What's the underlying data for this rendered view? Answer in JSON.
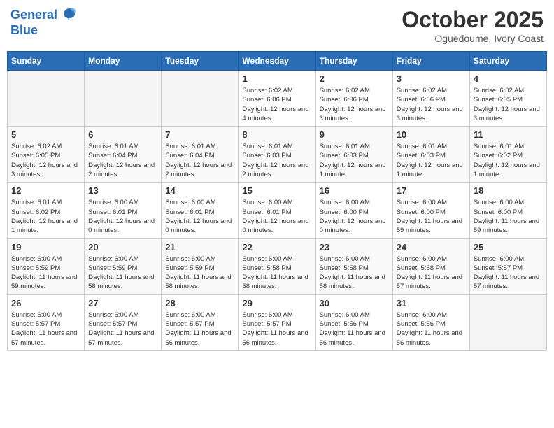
{
  "logo": {
    "line1": "General",
    "line2": "Blue"
  },
  "title": "October 2025",
  "location": "Oguedoume, Ivory Coast",
  "days_header": [
    "Sunday",
    "Monday",
    "Tuesday",
    "Wednesday",
    "Thursday",
    "Friday",
    "Saturday"
  ],
  "weeks": [
    {
      "days": [
        {
          "num": "",
          "info": ""
        },
        {
          "num": "",
          "info": ""
        },
        {
          "num": "",
          "info": ""
        },
        {
          "num": "1",
          "info": "Sunrise: 6:02 AM\nSunset: 6:06 PM\nDaylight: 12 hours and 4 minutes."
        },
        {
          "num": "2",
          "info": "Sunrise: 6:02 AM\nSunset: 6:06 PM\nDaylight: 12 hours and 3 minutes."
        },
        {
          "num": "3",
          "info": "Sunrise: 6:02 AM\nSunset: 6:06 PM\nDaylight: 12 hours and 3 minutes."
        },
        {
          "num": "4",
          "info": "Sunrise: 6:02 AM\nSunset: 6:05 PM\nDaylight: 12 hours and 3 minutes."
        }
      ]
    },
    {
      "days": [
        {
          "num": "5",
          "info": "Sunrise: 6:02 AM\nSunset: 6:05 PM\nDaylight: 12 hours and 3 minutes."
        },
        {
          "num": "6",
          "info": "Sunrise: 6:01 AM\nSunset: 6:04 PM\nDaylight: 12 hours and 2 minutes."
        },
        {
          "num": "7",
          "info": "Sunrise: 6:01 AM\nSunset: 6:04 PM\nDaylight: 12 hours and 2 minutes."
        },
        {
          "num": "8",
          "info": "Sunrise: 6:01 AM\nSunset: 6:03 PM\nDaylight: 12 hours and 2 minutes."
        },
        {
          "num": "9",
          "info": "Sunrise: 6:01 AM\nSunset: 6:03 PM\nDaylight: 12 hours and 1 minute."
        },
        {
          "num": "10",
          "info": "Sunrise: 6:01 AM\nSunset: 6:03 PM\nDaylight: 12 hours and 1 minute."
        },
        {
          "num": "11",
          "info": "Sunrise: 6:01 AM\nSunset: 6:02 PM\nDaylight: 12 hours and 1 minute."
        }
      ]
    },
    {
      "days": [
        {
          "num": "12",
          "info": "Sunrise: 6:01 AM\nSunset: 6:02 PM\nDaylight: 12 hours and 1 minute."
        },
        {
          "num": "13",
          "info": "Sunrise: 6:00 AM\nSunset: 6:01 PM\nDaylight: 12 hours and 0 minutes."
        },
        {
          "num": "14",
          "info": "Sunrise: 6:00 AM\nSunset: 6:01 PM\nDaylight: 12 hours and 0 minutes."
        },
        {
          "num": "15",
          "info": "Sunrise: 6:00 AM\nSunset: 6:01 PM\nDaylight: 12 hours and 0 minutes."
        },
        {
          "num": "16",
          "info": "Sunrise: 6:00 AM\nSunset: 6:00 PM\nDaylight: 12 hours and 0 minutes."
        },
        {
          "num": "17",
          "info": "Sunrise: 6:00 AM\nSunset: 6:00 PM\nDaylight: 11 hours and 59 minutes."
        },
        {
          "num": "18",
          "info": "Sunrise: 6:00 AM\nSunset: 6:00 PM\nDaylight: 11 hours and 59 minutes."
        }
      ]
    },
    {
      "days": [
        {
          "num": "19",
          "info": "Sunrise: 6:00 AM\nSunset: 5:59 PM\nDaylight: 11 hours and 59 minutes."
        },
        {
          "num": "20",
          "info": "Sunrise: 6:00 AM\nSunset: 5:59 PM\nDaylight: 11 hours and 58 minutes."
        },
        {
          "num": "21",
          "info": "Sunrise: 6:00 AM\nSunset: 5:59 PM\nDaylight: 11 hours and 58 minutes."
        },
        {
          "num": "22",
          "info": "Sunrise: 6:00 AM\nSunset: 5:58 PM\nDaylight: 11 hours and 58 minutes."
        },
        {
          "num": "23",
          "info": "Sunrise: 6:00 AM\nSunset: 5:58 PM\nDaylight: 11 hours and 58 minutes."
        },
        {
          "num": "24",
          "info": "Sunrise: 6:00 AM\nSunset: 5:58 PM\nDaylight: 11 hours and 57 minutes."
        },
        {
          "num": "25",
          "info": "Sunrise: 6:00 AM\nSunset: 5:57 PM\nDaylight: 11 hours and 57 minutes."
        }
      ]
    },
    {
      "days": [
        {
          "num": "26",
          "info": "Sunrise: 6:00 AM\nSunset: 5:57 PM\nDaylight: 11 hours and 57 minutes."
        },
        {
          "num": "27",
          "info": "Sunrise: 6:00 AM\nSunset: 5:57 PM\nDaylight: 11 hours and 57 minutes."
        },
        {
          "num": "28",
          "info": "Sunrise: 6:00 AM\nSunset: 5:57 PM\nDaylight: 11 hours and 56 minutes."
        },
        {
          "num": "29",
          "info": "Sunrise: 6:00 AM\nSunset: 5:57 PM\nDaylight: 11 hours and 56 minutes."
        },
        {
          "num": "30",
          "info": "Sunrise: 6:00 AM\nSunset: 5:56 PM\nDaylight: 11 hours and 56 minutes."
        },
        {
          "num": "31",
          "info": "Sunrise: 6:00 AM\nSunset: 5:56 PM\nDaylight: 11 hours and 56 minutes."
        },
        {
          "num": "",
          "info": ""
        }
      ]
    }
  ]
}
